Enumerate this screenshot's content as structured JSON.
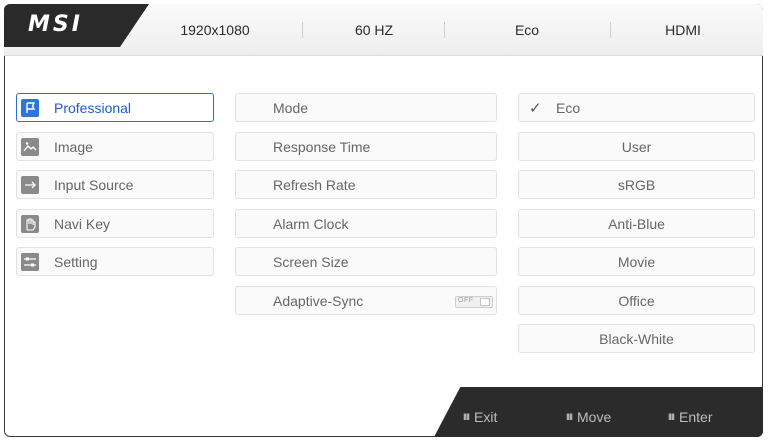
{
  "brand": {
    "logo_text": "MSI"
  },
  "status_bar": {
    "resolution": "1920x1080",
    "refresh": "60 HZ",
    "mode": "Eco",
    "input": "HDMI"
  },
  "menu": {
    "main_items": [
      {
        "label": "Professional",
        "icon": "flag-icon",
        "active": true
      },
      {
        "label": "Image",
        "icon": "image-icon",
        "active": false
      },
      {
        "label": "Input Source",
        "icon": "arrow-right-icon",
        "active": false
      },
      {
        "label": "Navi Key",
        "icon": "hand-icon",
        "active": false
      },
      {
        "label": "Setting",
        "icon": "sliders-icon",
        "active": false
      }
    ],
    "sub_items": [
      {
        "label": "Mode"
      },
      {
        "label": "Response Time"
      },
      {
        "label": "Refresh Rate"
      },
      {
        "label": "Alarm Clock"
      },
      {
        "label": "Screen Size"
      },
      {
        "label": "Adaptive-Sync",
        "toggle": "OFF"
      }
    ],
    "mode_options": [
      {
        "label": "Eco",
        "selected": true
      },
      {
        "label": "User"
      },
      {
        "label": "sRGB"
      },
      {
        "label": "Anti-Blue"
      },
      {
        "label": "Movie"
      },
      {
        "label": "Office"
      },
      {
        "label": "Black-White"
      }
    ]
  },
  "hints": {
    "exit": "Exit",
    "move": "Move",
    "enter": "Enter",
    "key_symbol": "IIII"
  },
  "colors": {
    "accent": "#2a6fd2",
    "dark": "#2b2b2b"
  }
}
